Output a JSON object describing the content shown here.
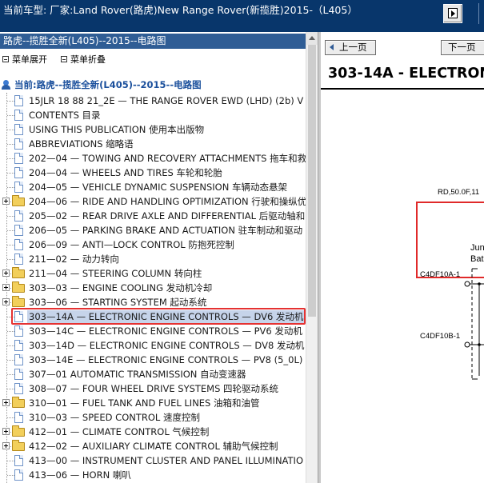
{
  "header": {
    "title": "当前车型:  厂家:Land Rover(路虎)New Range Rover(新揽胜)2015-（L405）",
    "nav_icon": "forward-page-icon"
  },
  "left": {
    "panel_title": "路虎--揽胜全新(L405)--2015--电路图",
    "expand_label": "菜单展开",
    "collapse_label": "菜单折叠",
    "root_label": "当前:路虎--揽胜全新(L405)--2015--电路图",
    "items": [
      {
        "label": "15JLR 18 88 21_2E — THE RANGE ROVER EWD (LHD) (2b) V",
        "type": "doc"
      },
      {
        "label": "CONTENTS 目录",
        "type": "doc"
      },
      {
        "label": "USING THIS PUBLICATION 使用本出版物",
        "type": "doc"
      },
      {
        "label": "ABBREVIATIONS 缩略语",
        "type": "doc"
      },
      {
        "label": "202—04 — TOWING AND RECOVERY ATTACHMENTS 拖车和救",
        "type": "doc"
      },
      {
        "label": "204—04 — WHEELS AND TIRES 车轮和轮胎",
        "type": "doc"
      },
      {
        "label": "204—05 — VEHICLE DYNAMIC SUSPENSION 车辆动态悬架",
        "type": "doc"
      },
      {
        "label": "204—06 — RIDE AND HANDLING OPTIMIZATION 行驶和操纵优",
        "type": "folder"
      },
      {
        "label": "205—02 — REAR DRIVE AXLE AND DIFFERENTIAL 后驱动轴和",
        "type": "doc"
      },
      {
        "label": "206—05 — PARKING BRAKE AND ACTUATION 驻车制动和驱动",
        "type": "doc"
      },
      {
        "label": "206—09 — ANTI—LOCK CONTROL 防抱死控制",
        "type": "doc"
      },
      {
        "label": "211—02 — 动力转向",
        "type": "doc"
      },
      {
        "label": "211—04 — STEERING COLUMN 转向柱",
        "type": "folder"
      },
      {
        "label": "303—03 — ENGINE COOLING 发动机冷却",
        "type": "folder"
      },
      {
        "label": "303—06 — STARTING SYSTEM 起动系统",
        "type": "folder"
      },
      {
        "label": "303—14A — ELECTRONIC ENGINE CONTROLS — DV6 发动机",
        "type": "doc",
        "selected": true
      },
      {
        "label": "303—14C — ELECTRONIC ENGINE CONTROLS — PV6 发动机",
        "type": "doc"
      },
      {
        "label": "303—14D — ELECTRONIC ENGINE CONTROLS — DV8 发动机",
        "type": "doc"
      },
      {
        "label": "303—14E — ELECTRONIC ENGINE CONTROLS — PV8 (5_0L)",
        "type": "doc"
      },
      {
        "label": "307—01 AUTOMATIC TRANSMISSION 自动变速器",
        "type": "doc"
      },
      {
        "label": "308—07 — FOUR WHEEL DRIVE SYSTEMS 四轮驱动系统",
        "type": "doc"
      },
      {
        "label": "310—01 — FUEL TANK AND FUEL LINES 油箱和油管",
        "type": "folder"
      },
      {
        "label": "310—03 — SPEED CONTROL 速度控制",
        "type": "doc"
      },
      {
        "label": "412—01 — CLIMATE CONTROL 气候控制",
        "type": "folder"
      },
      {
        "label": "412—02 — AUXILIARY CLIMATE CONTROL 辅助气候控制",
        "type": "folder"
      },
      {
        "label": "413—00 — INSTRUMENT CLUSTER AND PANEL ILLUMINATIO",
        "type": "doc"
      },
      {
        "label": "413—06 — HORN 喇叭",
        "type": "doc"
      }
    ]
  },
  "right": {
    "prev_label": "上一页",
    "next_label": "下一页",
    "doc_title": "303-14A - ELECTRONIC",
    "wire_label": "RD,50.0F,11",
    "junction_label_1": "Jun",
    "junction_label_2": "Bat",
    "connector_1": "C4DF10A-1",
    "connector_2": "C4DF10B-1"
  },
  "colors": {
    "header_bg": "#08366b",
    "panel_header_bg": "#2f5d95",
    "selection_border": "#e53232",
    "diagram_red": "#e02a2a"
  }
}
